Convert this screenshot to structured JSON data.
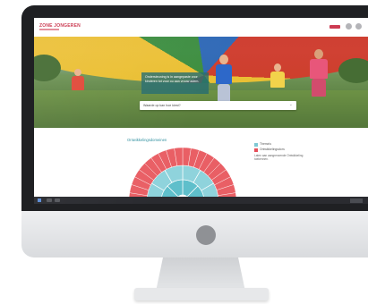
{
  "site": {
    "logo_text": "ZONE JONGEREN"
  },
  "hero": {
    "panel_text": "Ondersteuning is in aangepaste voor kinderen tot voor ou aan vrouw adem.",
    "search_placeholder": "Waarde op kan hoe kiest?"
  },
  "chart_section": {
    "title": "Ontwikkelingsdomeinen"
  },
  "legend": {
    "items": [
      {
        "label": "Thema's",
        "color": "#7ec8d3"
      },
      {
        "label": "Ontwikkelingsdom.",
        "color": "#e6505a"
      }
    ],
    "note": "Laten aan aangrenzende Ontwikkeling toekennen."
  },
  "chart_data": {
    "type": "sunburst",
    "title": "Ontwikkelingsdomeinen",
    "rings": [
      {
        "name": "inner",
        "segments": 8,
        "color": "#5fbfcb"
      },
      {
        "name": "middle",
        "segments": 12,
        "color": "#8fd3dc"
      },
      {
        "name": "outer",
        "segments": 40,
        "color": "#e95f65"
      }
    ]
  },
  "colors": {
    "accent_red": "#cc3b52",
    "accent_teal": "#2f8f9f",
    "monitor_bezel": "#1f2023"
  }
}
